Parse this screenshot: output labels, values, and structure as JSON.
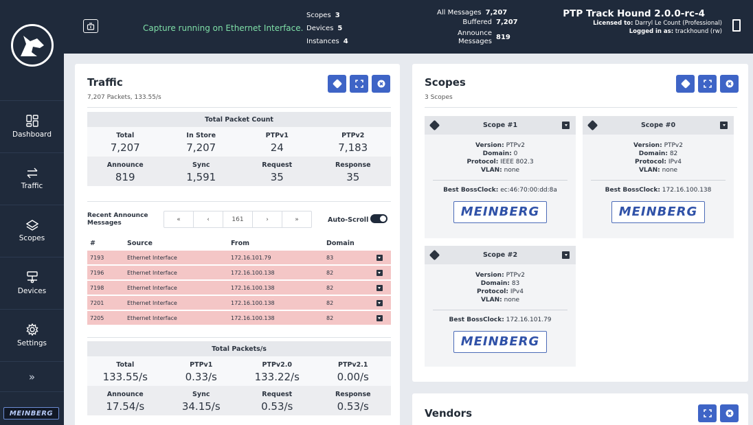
{
  "nav": {
    "items": [
      {
        "label": "Dashboard",
        "icon": "dashboard-icon"
      },
      {
        "label": "Traffic",
        "icon": "traffic-arrows-icon"
      },
      {
        "label": "Scopes",
        "icon": "scopes-layers-icon"
      },
      {
        "label": "Devices",
        "icon": "devices-network-icon"
      },
      {
        "label": "Settings",
        "icon": "settings-gear-icon"
      }
    ],
    "expand_glyph": "»",
    "brand": "MEINBERG"
  },
  "topbar": {
    "capture_status": "Capture running on Ethernet Interface.",
    "scopes_label": "Scopes",
    "scopes_value": "3",
    "devices_label": "Devices",
    "devices_value": "5",
    "instances_label": "Instances",
    "instances_value": "4",
    "all_messages_label": "All Messages",
    "all_messages_value": "7,207",
    "buffered_label": "Buffered",
    "buffered_value": "7,207",
    "announce_label": "Announce",
    "messages_label": "Messages",
    "announce_value": "819",
    "app_title": "PTP Track Hound 2.0.0-rc-4",
    "licensed_label": "Licensed to:",
    "licensed_value": "Darryl Le Count (Professional)",
    "logged_label": "Logged in as:",
    "logged_value": "trackhound (rw)"
  },
  "traffic": {
    "title": "Traffic",
    "subtitle": "7,207 Packets, 133.55/s",
    "total_count": {
      "header": "Total Packet Count",
      "row1": [
        {
          "label": "Total",
          "value": "7,207"
        },
        {
          "label": "In Store",
          "value": "7,207"
        },
        {
          "label": "PTPv1",
          "value": "24"
        },
        {
          "label": "PTPv2",
          "value": "7,183"
        }
      ],
      "row2": [
        {
          "label": "Announce",
          "value": "819"
        },
        {
          "label": "Sync",
          "value": "1,591"
        },
        {
          "label": "Request",
          "value": "35"
        },
        {
          "label": "Response",
          "value": "35"
        }
      ]
    },
    "recent": {
      "label": "Recent Announce Messages",
      "pager": [
        "«",
        "‹",
        "161",
        "›",
        "»"
      ],
      "autoscroll": "Auto-Scroll",
      "columns": [
        "#",
        "Source",
        "From",
        "Domain"
      ],
      "rows": [
        {
          "n": "7193",
          "source": "Ethernet Interface",
          "from": "172.16.101.79",
          "domain": "83"
        },
        {
          "n": "7196",
          "source": "Ethernet Interface",
          "from": "172.16.100.138",
          "domain": "82"
        },
        {
          "n": "7198",
          "source": "Ethernet Interface",
          "from": "172.16.100.138",
          "domain": "82"
        },
        {
          "n": "7201",
          "source": "Ethernet Interface",
          "from": "172.16.100.138",
          "domain": "82"
        },
        {
          "n": "7205",
          "source": "Ethernet Interface",
          "from": "172.16.100.138",
          "domain": "82"
        }
      ]
    },
    "rates": {
      "header": "Total Packets/s",
      "row1": [
        {
          "label": "Total",
          "value": "133.55/s"
        },
        {
          "label": "PTPv1",
          "value": "0.33/s"
        },
        {
          "label": "PTPv2.0",
          "value": "133.22/s"
        },
        {
          "label": "PTPv2.1",
          "value": "0.00/s"
        }
      ],
      "row2": [
        {
          "label": "Announce",
          "value": "17.54/s"
        },
        {
          "label": "Sync",
          "value": "34.15/s"
        },
        {
          "label": "Request",
          "value": "0.53/s"
        },
        {
          "label": "Response",
          "value": "0.53/s"
        }
      ]
    }
  },
  "scopes": {
    "title": "Scopes",
    "subtitle": "3 Scopes",
    "items": [
      {
        "name": "Scope #1",
        "version": "PTPv2",
        "domain": "0",
        "protocol": "IEEE 802.3",
        "vlan": "none",
        "bossclock": "ec:46:70:00:dd:8a",
        "brand": "MEINBERG"
      },
      {
        "name": "Scope #0",
        "version": "PTPv2",
        "domain": "82",
        "protocol": "IPv4",
        "vlan": "none",
        "bossclock": "172.16.100.138",
        "brand": "MEINBERG"
      },
      {
        "name": "Scope #2",
        "version": "PTPv2",
        "domain": "83",
        "protocol": "IPv4",
        "vlan": "none",
        "bossclock": "172.16.101.79",
        "brand": "MEINBERG"
      }
    ],
    "labels": {
      "version": "Version:",
      "domain": "Domain:",
      "protocol": "Protocol:",
      "vlan": "VLAN:",
      "bossclock": "Best BossClock:"
    }
  },
  "vendors": {
    "title": "Vendors"
  }
}
